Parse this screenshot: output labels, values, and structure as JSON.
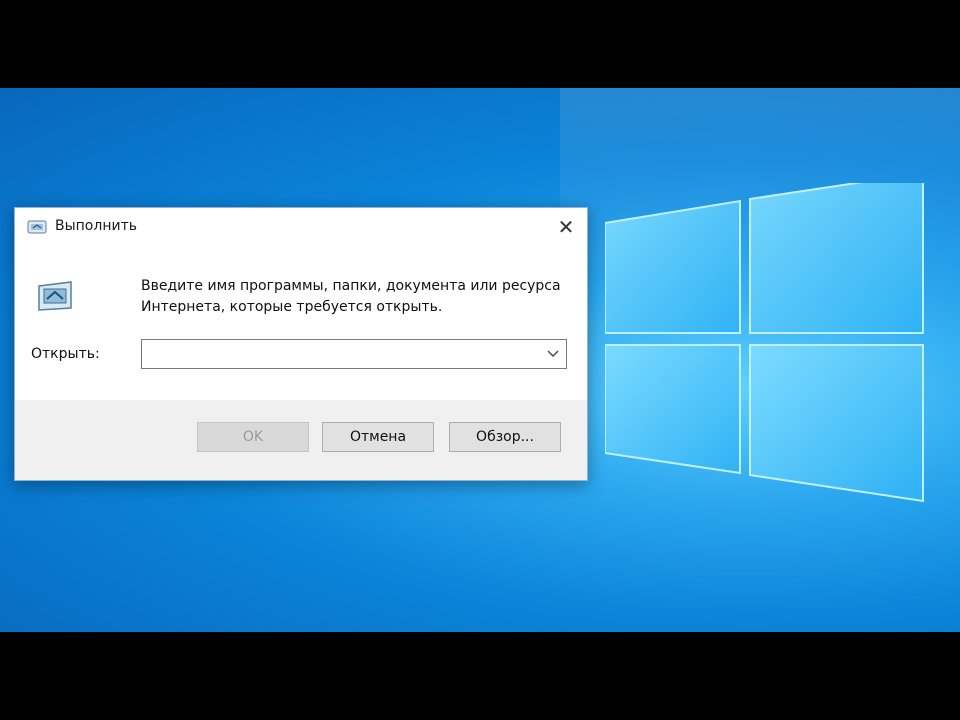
{
  "dialog": {
    "title": "Выполнить",
    "description": "Введите имя программы, папки, документа или ресурса Интернета, которые требуется открыть.",
    "open_label": "Открыть:",
    "open_value": "",
    "buttons": {
      "ok": "OK",
      "cancel": "Отмена",
      "browse": "Обзор..."
    },
    "close_glyph": "✕"
  },
  "icons": {
    "title": "run-icon",
    "large": "run-icon",
    "dropdown": "chevron-down-icon",
    "desktop_logo": "windows-logo-icon"
  },
  "colors": {
    "desktop_blue": "#0b84d9",
    "dialog_bg": "#ffffff",
    "footer_bg": "#f0f0f0"
  }
}
